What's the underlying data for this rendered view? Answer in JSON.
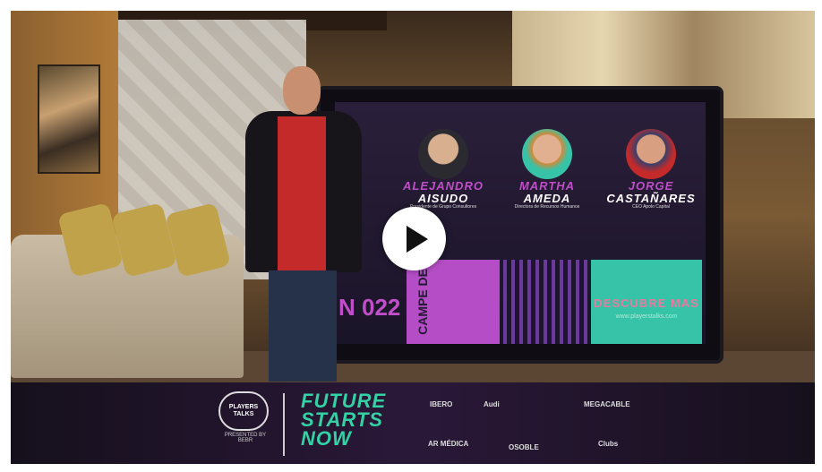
{
  "screen": {
    "speakers": [
      {
        "first": "ALEJANDRO",
        "last": "AISUDO",
        "role": "Presidente de Grupo Consultores"
      },
      {
        "first": "MARTHA",
        "last": "AMEDA",
        "role": "Directora de Recursos Humanos"
      },
      {
        "first": "JORGE",
        "last": "CASTAÑARES",
        "role": "CEO Apolo Capital"
      }
    ],
    "campe_text": "CAMPE DE",
    "year_text": "N\n022",
    "cta_title": "DESCUBRE MAS",
    "cta_url": "www.playerstalks.com"
  },
  "player": {
    "play_button_label": "Play"
  },
  "banner": {
    "logo_line1": "PLAYERS",
    "logo_line2": "TALKS",
    "logo_sub": "PRESENTED BY BEBR",
    "slogan_lines": [
      "FUTURE",
      "STARTS",
      "NOW"
    ],
    "sponsors": [
      "IBERO",
      "Audi",
      "MEGACABLE",
      "AR MÉDICA",
      "OSOBLE",
      "Clubs"
    ]
  },
  "colors": {
    "accent_purple": "#c04ec8",
    "accent_teal": "#37c3a8",
    "slogan_green": "#33d1a4"
  }
}
